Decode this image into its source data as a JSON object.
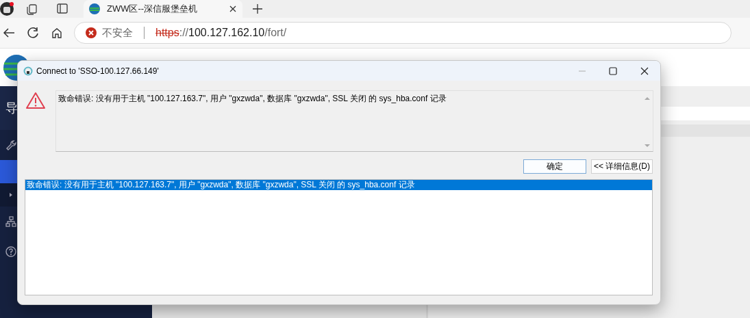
{
  "browser": {
    "tab": {
      "title": "ZWW区--深信服堡垒机"
    },
    "address": {
      "security": "不安全",
      "url_parts": [
        {
          "text": "https",
          "kind": "scheme"
        },
        {
          "text": "://",
          "kind": "dim"
        },
        {
          "text": "100.127.162.10",
          "kind": "host"
        },
        {
          "text": "/fort/",
          "kind": "dim"
        }
      ]
    }
  },
  "page": {
    "sidebar": {
      "title": "导",
      "items": [
        {
          "kind": "wrench",
          "selected": false
        },
        {
          "kind": "blank",
          "selected": true
        },
        {
          "kind": "caret",
          "selected": false
        },
        {
          "kind": "network",
          "selected": false
        },
        {
          "kind": "help",
          "selected": false
        }
      ]
    }
  },
  "dialog": {
    "title": "Connect to 'SSO-100.127.66.149'",
    "message": "致命错误: 没有用于主机 \"100.127.163.7\", 用户 \"gxzwda\", 数据库 \"gxzwda\", SSL 关闭 的 sys_hba.conf 记录",
    "buttons": [
      {
        "label": "确定",
        "default": true
      },
      {
        "label": "<< 详细信息(D)",
        "default": false
      }
    ],
    "details": [
      {
        "text": "致命错误: 没有用于主机 \"100.127.163.7\", 用户 \"gxzwda\", 数据库 \"gxzwda\", SSL 关闭 的 sys_hba.conf 记录",
        "selected": true
      }
    ]
  }
}
